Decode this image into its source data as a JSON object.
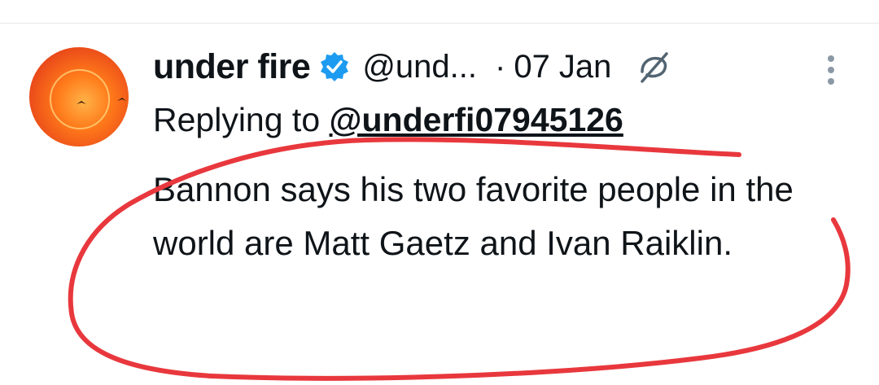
{
  "tweet": {
    "display_name": "under fire",
    "handle": "@und...",
    "separator": "·",
    "date": "07 Jan",
    "reply_prefix": "Replying to",
    "reply_mention": "@underfi07945126",
    "text": "Bannon says his two favorite people in the world are Matt Gaetz and Ivan Raiklin."
  },
  "icons": {
    "verified": "verified-badge-icon",
    "grok": "grok-slash-icon",
    "more": "more-vertical-icon"
  },
  "colors": {
    "verified_blue": "#1d9bf0",
    "annotation_red": "#e8383d",
    "avatar_orange": "#ff7a1a"
  }
}
